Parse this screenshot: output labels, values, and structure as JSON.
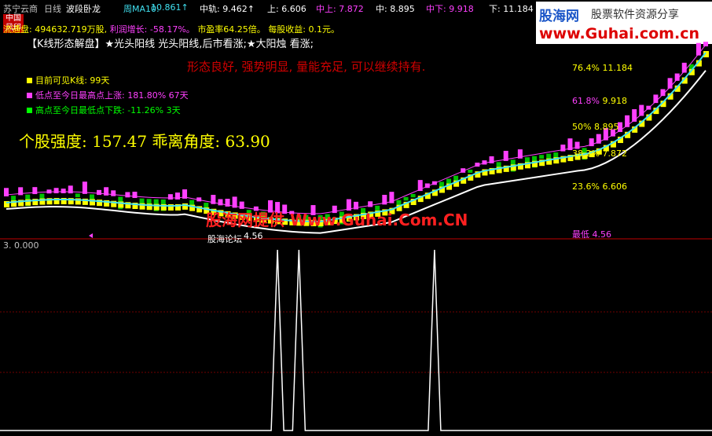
{
  "header": {
    "stock": "苏宁云商",
    "period": "日线",
    "indicator": "波段卧龙",
    "ma_label": "周MA10:",
    "ma_value": "10.861↑",
    "mid_label": "中轨: 9.462↑",
    "up_label": "上: 6.606",
    "mid_up_label": "中上: 7.872",
    "mid2_label": "中: 8.895",
    "mid_down_label": "中下: 9.918",
    "down_label": "下: 11.184"
  },
  "tag": {
    "line1": "中国",
    "line2": "风印"
  },
  "brand": {
    "name": "股海网",
    "slogan": "股票软件资源分享",
    "url": "www.Guhai.com.cn"
  },
  "info_line": {
    "float_shares": "流通盘: 494632.719万股,",
    "profit_growth": "利润增长: -58.17%。",
    "pe": "市盈率64.25倍。",
    "eps": "每股收益: 0.1元。"
  },
  "pattern_line": "【K线形态解盘】★光头阳线 光头阳线,后市看涨;★大阳烛 看涨;",
  "comment": "形态良好, 强势明显, 量能充足, 可以继续持有.",
  "legend": [
    {
      "label": "目前可见K线: 99天",
      "color": "#ffff00"
    },
    {
      "label": "低点至今日最高点上涨: 181.80% 67天",
      "color": "#ff40ff"
    },
    {
      "label": "高点至今日最低点下跌: -11.26% 3天",
      "color": "#00ff00"
    }
  ],
  "strength": "个股强度: 157.47 乖离角度: 63.90",
  "fib_levels": [
    {
      "pct": "76.4%",
      "price": "11.184"
    },
    {
      "pct": "61.8%",
      "price": "9.918"
    },
    {
      "pct": "50%",
      "price": "8.895"
    },
    {
      "pct": "38.2%",
      "price": "7.872"
    },
    {
      "pct": "23.6%",
      "price": "6.606"
    }
  ],
  "low_label": "最低 4.56",
  "low_point_label": "4.56",
  "low_point_prefix": "股海论坛",
  "watermark": "股海网提供 Www.Guhai.Com.CN",
  "lower_panel": {
    "label": "3. 0.000",
    "spike_bars": [
      38,
      41,
      60
    ]
  },
  "colors": {
    "up": "#ff40ff",
    "down": "#00c000",
    "band": "#ffff00",
    "cyan": "#40e0f0",
    "grid": "#900000"
  }
}
